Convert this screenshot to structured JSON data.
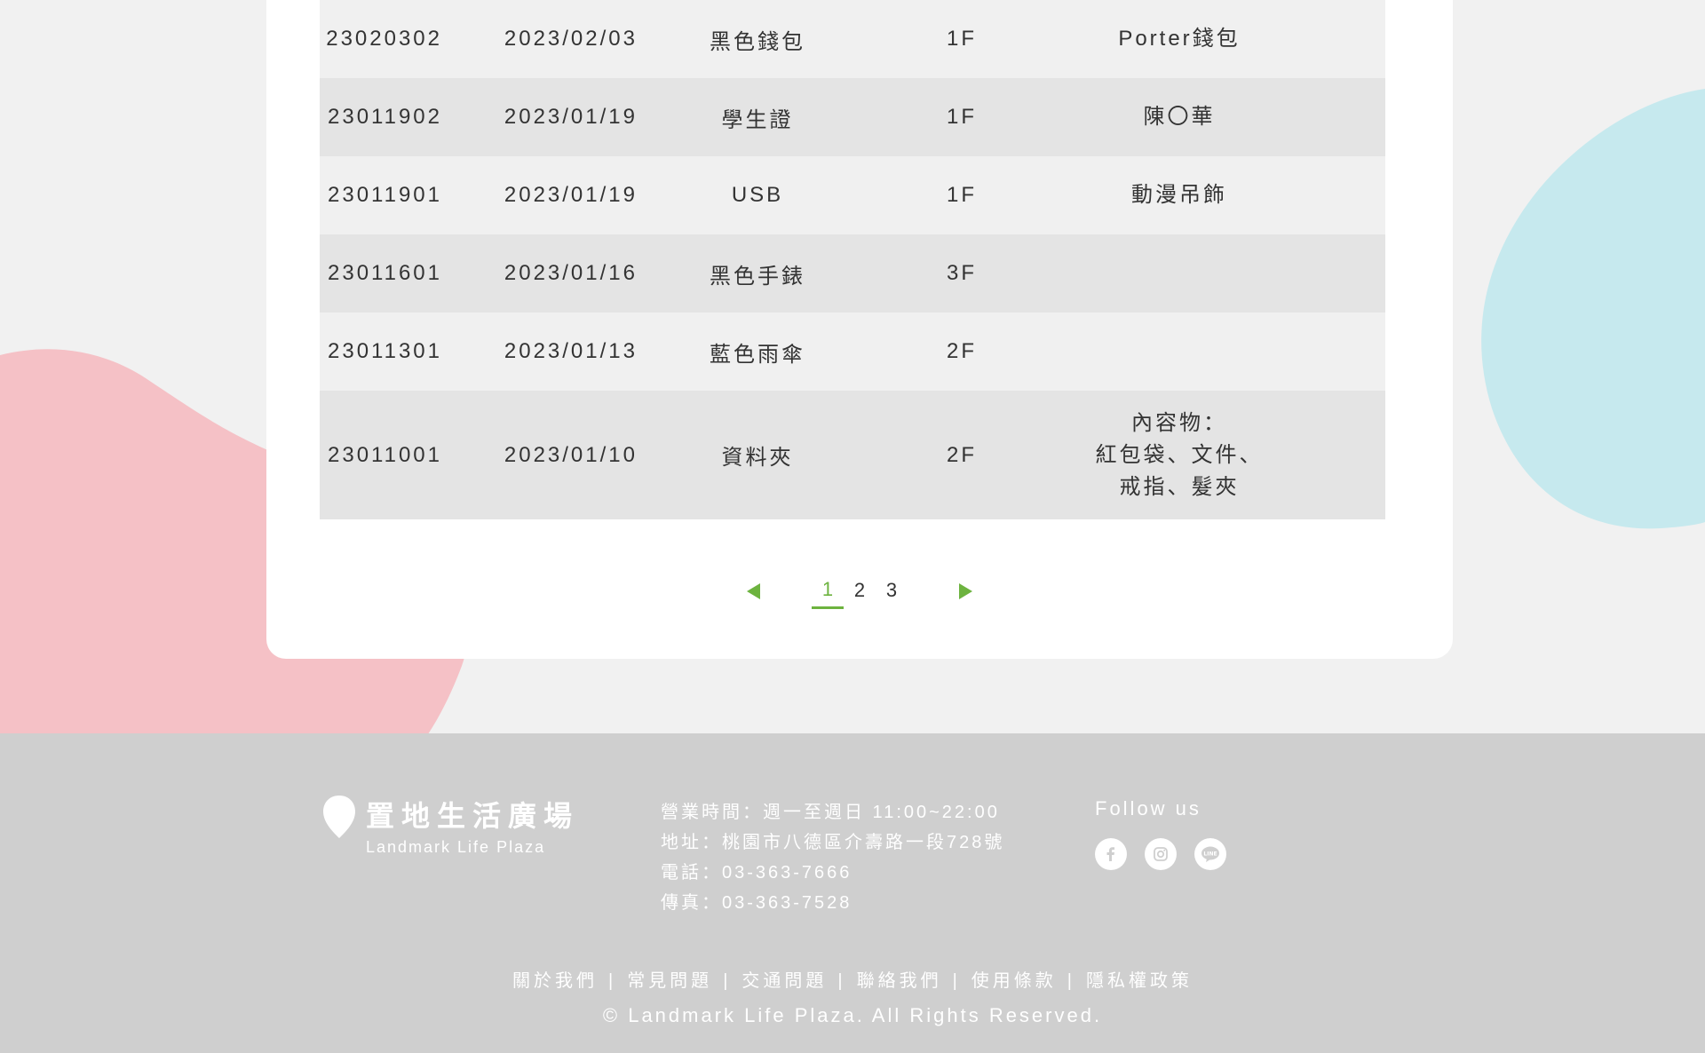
{
  "table": {
    "rows": [
      {
        "id": "23020302",
        "date": "2023/02/03",
        "item": "黑色錢包",
        "floor": "1F",
        "note": "Porter錢包"
      },
      {
        "id": "23011902",
        "date": "2023/01/19",
        "item": "學生證",
        "floor": "1F",
        "note": "陳〇華"
      },
      {
        "id": "23011901",
        "date": "2023/01/19",
        "item": "USB",
        "floor": "1F",
        "note": "動漫吊飾"
      },
      {
        "id": "23011601",
        "date": "2023/01/16",
        "item": "黑色手錶",
        "floor": "3F",
        "note": ""
      },
      {
        "id": "23011301",
        "date": "2023/01/13",
        "item": "藍色雨傘",
        "floor": "2F",
        "note": ""
      },
      {
        "id": "23011001",
        "date": "2023/01/10",
        "item": "資料夾",
        "floor": "2F",
        "note_lines": [
          "內容物：",
          "紅包袋、文件、",
          "戒指、髮夾"
        ]
      }
    ]
  },
  "pagination": {
    "pages": [
      "1",
      "2",
      "3"
    ],
    "current": "1"
  },
  "footer": {
    "logo_cn": "置地生活廣場",
    "logo_en": "Landmark Life Plaza",
    "hours": "營業時間：週一至週日 11:00~22:00",
    "address": "地址：桃園市八德區介壽路一段728號",
    "phone": "電話：03-363-7666",
    "fax": "傳真：03-363-7528",
    "follow_label": "Follow us",
    "social_icons": [
      "facebook-icon",
      "instagram-icon",
      "line-icon"
    ],
    "links": [
      "關於我們",
      "常見問題",
      "交通問題",
      "聯絡我們",
      "使用條款",
      "隱私權政策"
    ],
    "separator": "|",
    "copyright": "© Landmark Life Plaza. All Rights Reserved."
  },
  "colors": {
    "accent": "#6db33f",
    "pink_blob": "#f5c1c6",
    "blue_blob": "#c6e9ee",
    "footer_bg": "#cfcfcf",
    "page_bg": "#f1f1f1"
  }
}
